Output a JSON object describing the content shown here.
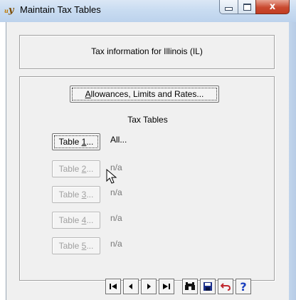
{
  "window": {
    "title": "Maintain Tax Tables",
    "app_icon": "tax-app-icon",
    "app_icon_text": "y",
    "app_icon_sup": "u",
    "caption_buttons": [
      "minimize-icon",
      "maximize-icon",
      "close-icon"
    ],
    "close_glyph": "x"
  },
  "info": {
    "text": "Tax information for Illinois (IL)"
  },
  "main": {
    "allowances_button": {
      "label_prefix": "",
      "label_mnemonic": "A",
      "label_rest": "llowances, Limits and Rates..."
    },
    "section_label": "Tax Tables",
    "tables": [
      {
        "label_prefix": "Table ",
        "mnemonic": "1",
        "suffix": "...",
        "value": "All...",
        "enabled": true
      },
      {
        "label_prefix": "Table ",
        "mnemonic": "2",
        "suffix": "...",
        "value": "n/a",
        "enabled": false
      },
      {
        "label_prefix": "Table ",
        "mnemonic": "3",
        "suffix": "...",
        "value": "n/a",
        "enabled": false
      },
      {
        "label_prefix": "Table ",
        "mnemonic": "4",
        "suffix": "...",
        "value": "n/a",
        "enabled": false
      },
      {
        "label_prefix": "Table ",
        "mnemonic": "5",
        "suffix": "...",
        "value": "n/a",
        "enabled": false
      }
    ]
  },
  "toolbar": {
    "buttons": [
      "first-record-icon",
      "previous-record-icon",
      "next-record-icon",
      "last-record-icon",
      "find-binoculars-icon",
      "save-disk-icon",
      "undo-icon",
      "help-question-icon"
    ],
    "help_glyph": "?"
  },
  "colors": {
    "help": "#1a3fbf",
    "undo": "#c0282e",
    "save": "#1b2f8a"
  }
}
